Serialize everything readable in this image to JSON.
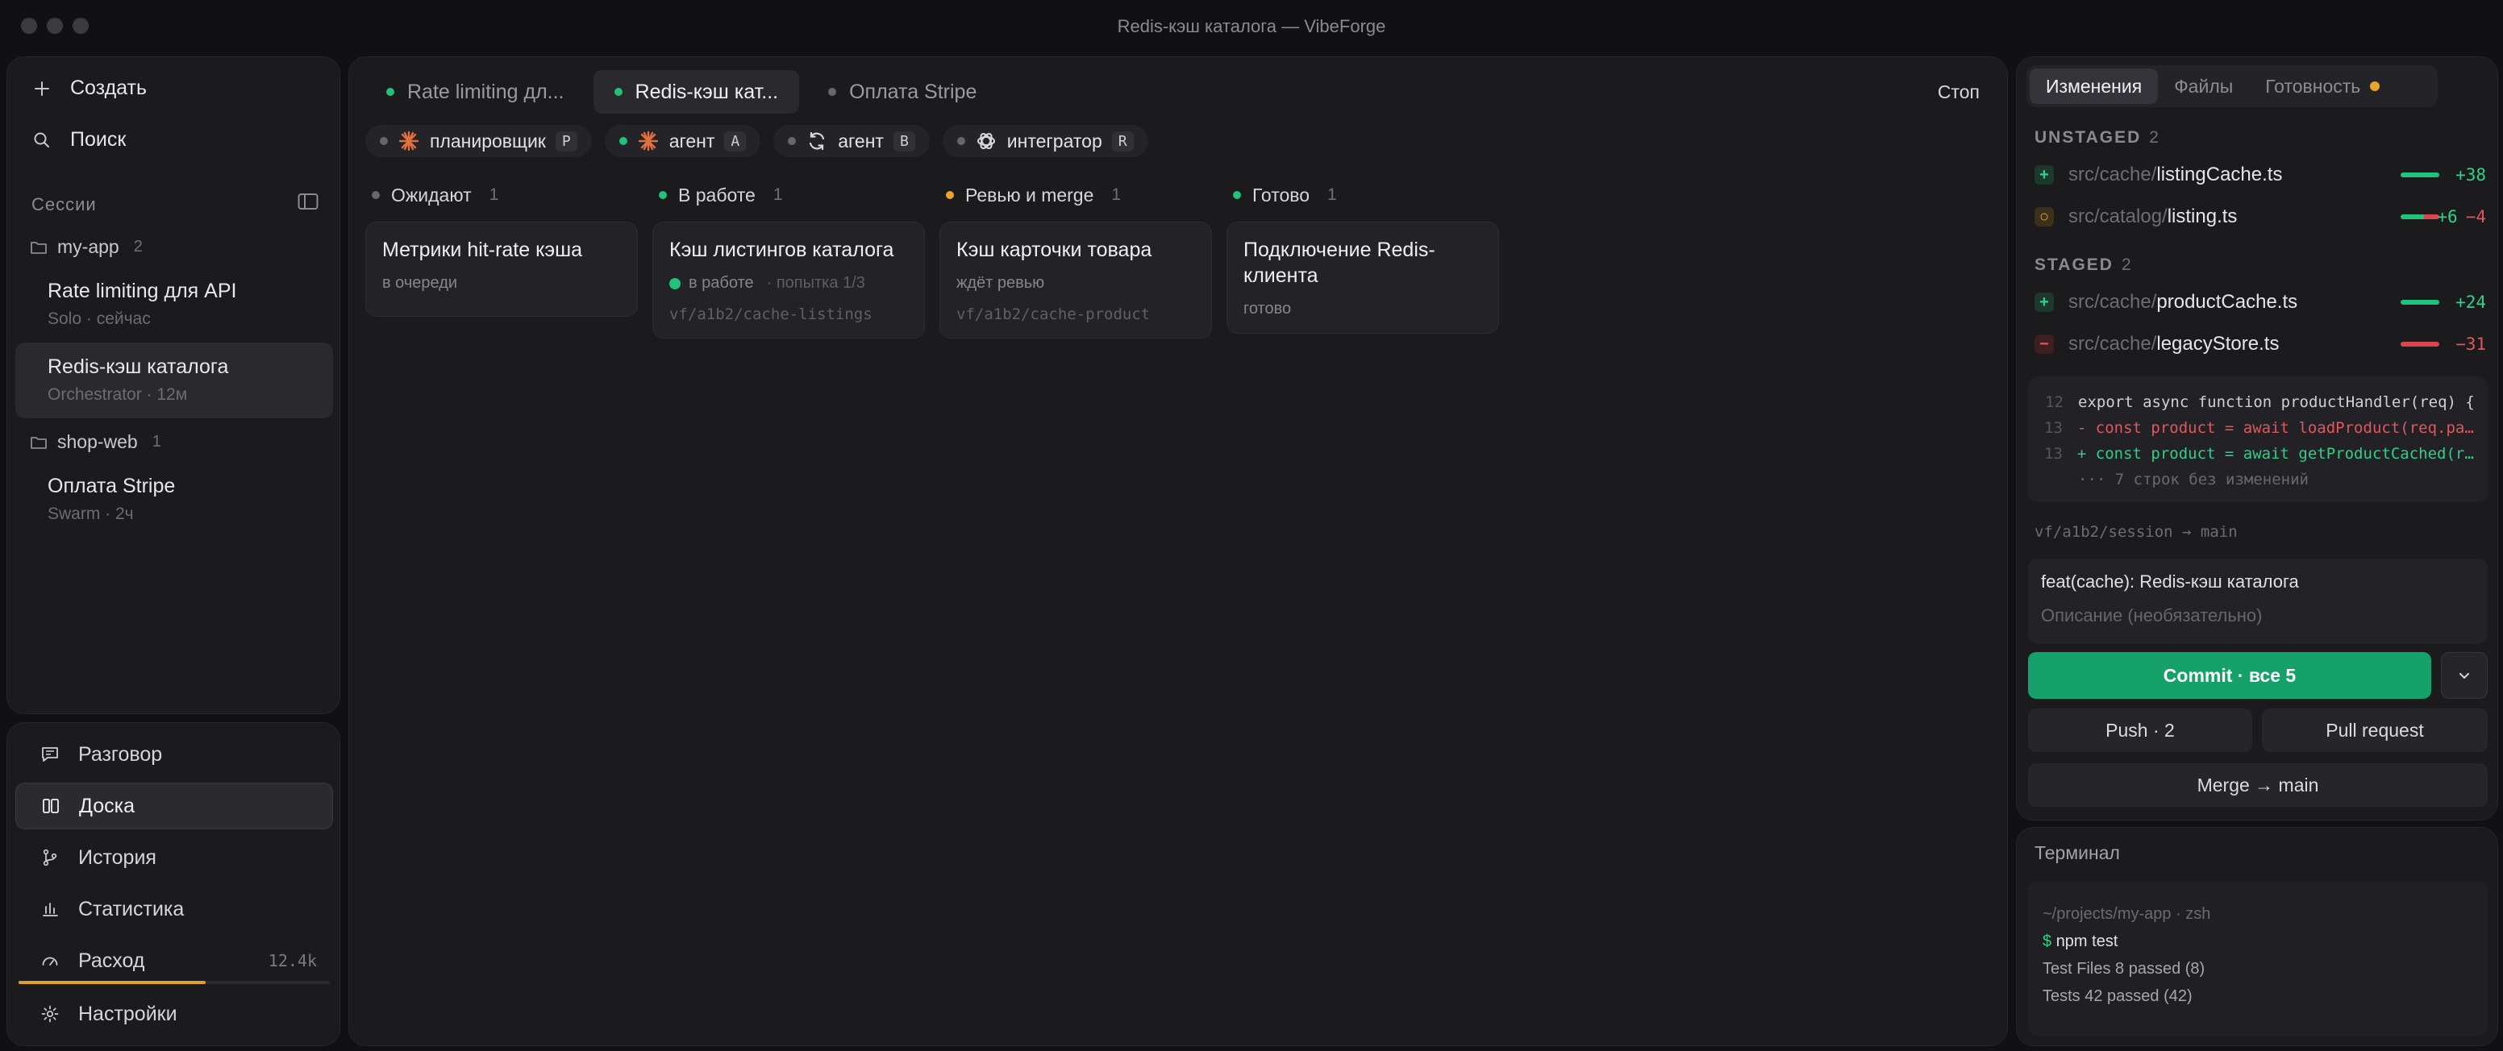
{
  "window": {
    "title": "Redis-кэш каталога — VibeForge"
  },
  "sidebar": {
    "create_label": "Создать",
    "search_label": "Поиск",
    "sessions_label": "Сессии",
    "groups": [
      {
        "name": "my-app",
        "count": "2",
        "sessions": [
          {
            "title": "Rate limiting для API",
            "subtitle": "Solo · сейчас"
          },
          {
            "title": "Redis-кэш каталога",
            "subtitle": "Orchestrator · 12м"
          }
        ]
      },
      {
        "name": "shop-web",
        "count": "1",
        "sessions": [
          {
            "title": "Оплата Stripe",
            "subtitle": "Swarm · 2ч"
          }
        ]
      }
    ],
    "nav": [
      {
        "label": "Разговор",
        "icon": "chat-icon"
      },
      {
        "label": "Доска",
        "icon": "board-icon"
      },
      {
        "label": "История",
        "icon": "git-branch-icon"
      },
      {
        "label": "Статистика",
        "icon": "bar-chart-icon"
      },
      {
        "label": "Расход",
        "icon": "gauge-icon",
        "value": "12.4k",
        "fill": 0.6
      },
      {
        "label": "Настройки",
        "icon": "gear-icon"
      }
    ]
  },
  "main": {
    "tabs": [
      {
        "label": "Rate limiting дл...",
        "status": "green"
      },
      {
        "label": "Redis-кэш кат...",
        "status": "green"
      },
      {
        "label": "Оплата Stripe",
        "status": "gray"
      }
    ],
    "stop_label": "Стоп",
    "agents": [
      {
        "label": "планировщик",
        "key": "P",
        "icon": "sparkle-icon",
        "status": "gray"
      },
      {
        "label": "агент",
        "key": "A",
        "icon": "sparkle-icon",
        "status": "green"
      },
      {
        "label": "агент",
        "key": "B",
        "icon": "sync-icon",
        "status": "gray"
      },
      {
        "label": "интегратор",
        "key": "R",
        "icon": "openai-icon",
        "status": "gray"
      }
    ],
    "columns": [
      {
        "title": "Ожидают",
        "count": "1",
        "status": "gray",
        "card": {
          "title": "Метрики hit-rate кэша",
          "status": "в очереди"
        }
      },
      {
        "title": "В работе",
        "count": "1",
        "status": "green",
        "card": {
          "title": "Кэш листингов каталога",
          "status": "в работе",
          "attempt": "· попытка 1/3",
          "branch": "vf/a1b2/cache-listings"
        }
      },
      {
        "title": "Ревью и merge",
        "count": "1",
        "status": "yellow",
        "card": {
          "title": "Кэш карточки товара",
          "status": "ждёт ревью",
          "branch": "vf/a1b2/cache-product"
        }
      },
      {
        "title": "Готово",
        "count": "1",
        "status": "green",
        "card": {
          "title": "Подключение Redis-клиента",
          "status": "готово"
        }
      }
    ]
  },
  "changes": {
    "tabs": [
      "Изменения",
      "Файлы",
      "Готовность"
    ],
    "unstaged_label": "UNSTAGED",
    "unstaged_count": "2",
    "staged_label": "STAGED",
    "staged_count": "2",
    "unstaged": [
      {
        "badge": "+",
        "dir": "src/cache/",
        "name": "listingCache.ts",
        "add": "+38",
        "del": ""
      },
      {
        "badge": "○",
        "dir": "src/catalog/",
        "name": "listing.ts",
        "add": "+6",
        "del": "−4"
      }
    ],
    "staged": [
      {
        "badge": "+",
        "dir": "src/cache/",
        "name": "productCache.ts",
        "add": "+24",
        "del": ""
      },
      {
        "badge": "−",
        "dir": "src/cache/",
        "name": "legacyStore.ts",
        "add": "",
        "del": "−31"
      }
    ],
    "diff": [
      {
        "ln": "12",
        "text": "export async function productHandler(req) {"
      },
      {
        "ln": "13",
        "text": "- const product = await loadProduct(req.params...."
      },
      {
        "ln": "13",
        "text": "+ const product = await getProductCached(req...."
      },
      {
        "ln": "",
        "text": "··· 7 строк без изменений"
      }
    ],
    "branch": "vf/a1b2/session  →  main",
    "commit_title": "feat(cache): Redis-кэш каталога",
    "commit_desc_placeholder": "Описание (необязательно)",
    "commit_label": "Commit · все 5",
    "push_label": "Push · 2",
    "pr_label": "Pull request",
    "merge_label": "Merge → main"
  },
  "terminal": {
    "title": "Терминал",
    "path": "~/projects/my-app · zsh",
    "prompt": "$",
    "command": "npm test",
    "lines": [
      "Test Files 8 passed (8)",
      "Tests 42 passed (42)"
    ]
  }
}
